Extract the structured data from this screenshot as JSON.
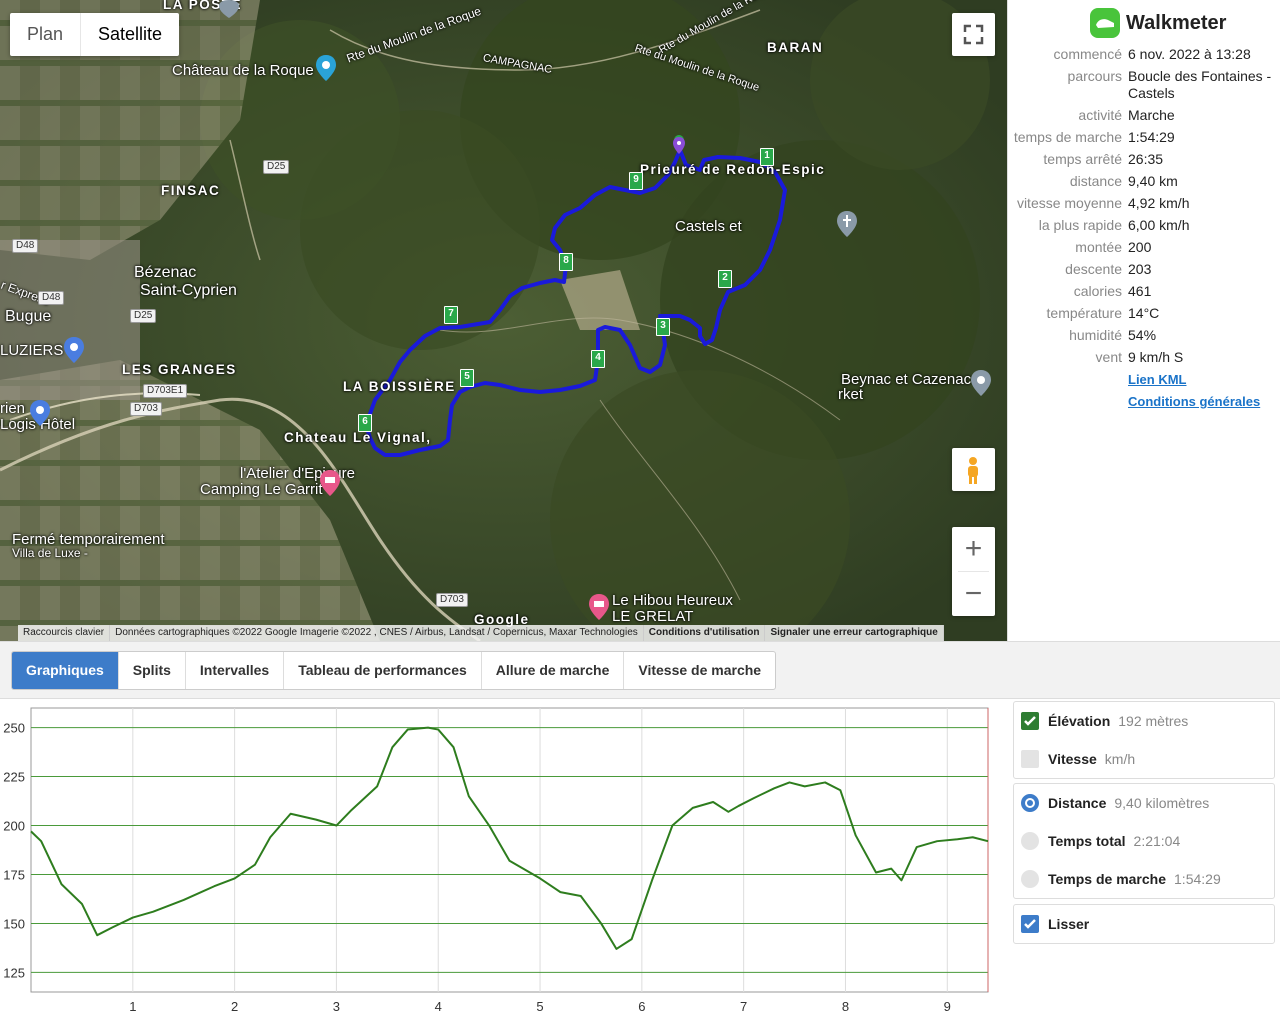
{
  "map": {
    "type_buttons": [
      "Plan",
      "Satellite"
    ],
    "active_type": "Satellite",
    "place_labels": [
      {
        "text": "LA POSTE"
      },
      {
        "text": "Château de la Roque"
      },
      {
        "text": "BARAN"
      },
      {
        "text": "Rte du Moulin de la Roque"
      },
      {
        "text": "Rte du Moulin de la Roque"
      },
      {
        "text": "Rte du Moulin de la Roque"
      },
      {
        "text": "CAMPAGNAC"
      },
      {
        "text": "FINSAC"
      },
      {
        "text": "Prieuré de Redon-Espic"
      },
      {
        "text": "Castels et"
      },
      {
        "text": "Bézenac"
      },
      {
        "text": "Saint-Cyprien"
      },
      {
        "text": "Bugue"
      },
      {
        "text": "r Express"
      },
      {
        "text": "LUZIERS"
      },
      {
        "text": "LES GRANGES"
      },
      {
        "text": "LA BOISSIÈRE"
      },
      {
        "text": "Chateau Le Vignal,"
      },
      {
        "text": "Beynac et Cazenac"
      },
      {
        "text": "rket"
      },
      {
        "text": "rien"
      },
      {
        "text": "Logis Hôtel"
      },
      {
        "text": "l'Atelier d'Epicure"
      },
      {
        "text": "Camping Le Garrit"
      },
      {
        "text": "Fermé temporairement"
      },
      {
        "text": "Villa de Luxe -"
      },
      {
        "text": "Le Hibou Heureux"
      },
      {
        "text": "LE GRELAT"
      },
      {
        "text": "Google"
      }
    ],
    "road_labels": [
      "D25",
      "D48",
      "D48",
      "D25",
      "D703E1",
      "D703",
      "D703"
    ],
    "markers": [
      "1",
      "2",
      "3",
      "4",
      "5",
      "6",
      "7",
      "8",
      "9"
    ],
    "attribution": [
      "Raccourcis clavier",
      "Données cartographiques ©2022 Google Imagerie ©2022 , CNES / Airbus, Landsat / Copernicus, Maxar Technologies",
      "Conditions d'utilisation",
      "Signaler une erreur cartographique"
    ],
    "icons": [
      "fullscreen-icon",
      "pegman-icon",
      "zoom-in-icon",
      "zoom-out-icon"
    ]
  },
  "info": {
    "brand": "Walkmeter",
    "rows": [
      {
        "k": "commencé",
        "v": "6 nov. 2022 à 13:28"
      },
      {
        "k": "parcours",
        "v": "Boucle des Fontaines - Castels"
      },
      {
        "k": "activité",
        "v": "Marche"
      },
      {
        "k": "temps de marche",
        "v": "1:54:29"
      },
      {
        "k": "temps arrêté",
        "v": "26:35"
      },
      {
        "k": "distance",
        "v": "9,40 km"
      },
      {
        "k": "vitesse moyenne",
        "v": "4,92 km/h"
      },
      {
        "k": "la plus rapide",
        "v": "6,00 km/h"
      },
      {
        "k": "montée",
        "v": "200"
      },
      {
        "k": "descente",
        "v": "203"
      },
      {
        "k": "calories",
        "v": "461"
      },
      {
        "k": "température",
        "v": "14°C"
      },
      {
        "k": "humidité",
        "v": "54%"
      },
      {
        "k": "vent",
        "v": "9 km/h S"
      }
    ],
    "links": [
      "Lien KML",
      "Conditions générales"
    ]
  },
  "tabs": [
    "Graphiques",
    "Splits",
    "Intervalles",
    "Tableau de performances",
    "Allure de marche",
    "Vitesse de marche"
  ],
  "active_tab": "Graphiques",
  "series_panel": {
    "elevation": {
      "label": "Élévation",
      "value": "192 mètres",
      "checked": true
    },
    "speed": {
      "label": "Vitesse",
      "value": "km/h",
      "checked": false
    },
    "distance": {
      "label": "Distance",
      "value": "9,40 kilomètres",
      "selected": true
    },
    "total_time": {
      "label": "Temps total",
      "value": "2:21:04"
    },
    "moving_time": {
      "label": "Temps de marche",
      "value": "1:54:29"
    },
    "smooth": {
      "label": "Lisser",
      "checked": true
    }
  },
  "colors": {
    "accent": "#3d7cc9",
    "route": "#1a1adb",
    "elevation_line": "#2e7d1e",
    "grid": "#4a9a3a"
  },
  "chart_data": {
    "type": "line",
    "xlabel": "",
    "ylabel": "",
    "xlim": [
      0,
      9.4
    ],
    "ylim": [
      115,
      260
    ],
    "xticks": [
      "1",
      "2",
      "3",
      "4",
      "5",
      "6",
      "7",
      "8",
      "9"
    ],
    "yticks": [
      "125",
      "150",
      "175",
      "200",
      "225",
      "250"
    ],
    "grid": true,
    "series": [
      {
        "x": [
          0,
          0.1,
          0.3,
          0.5,
          0.65,
          0.8,
          1.0,
          1.2,
          1.5,
          1.8,
          2.0,
          2.2,
          2.35,
          2.55,
          2.8,
          3.0,
          3.15,
          3.4,
          3.55,
          3.7,
          3.9,
          4.0,
          4.15,
          4.3,
          4.5,
          4.7,
          4.8,
          5.0,
          5.2,
          5.4,
          5.6,
          5.75,
          5.9,
          6.1,
          6.3,
          6.5,
          6.7,
          6.85,
          6.95,
          7.1,
          7.3,
          7.45,
          7.6,
          7.8,
          7.95,
          8.1,
          8.3,
          8.45,
          8.55,
          8.7,
          8.9,
          9.1,
          9.25,
          9.4
        ],
        "y": [
          197,
          192,
          170,
          160,
          144,
          148,
          153,
          156,
          162,
          169,
          173,
          180,
          194,
          206,
          203,
          200,
          208,
          220,
          240,
          249,
          250,
          249,
          240,
          215,
          200,
          182,
          179,
          173,
          166,
          164,
          150,
          137,
          142,
          172,
          200,
          209,
          212,
          207,
          210,
          214,
          219,
          222,
          220,
          222,
          218,
          195,
          176,
          178,
          172,
          189,
          192,
          193,
          194,
          192
        ]
      }
    ]
  }
}
